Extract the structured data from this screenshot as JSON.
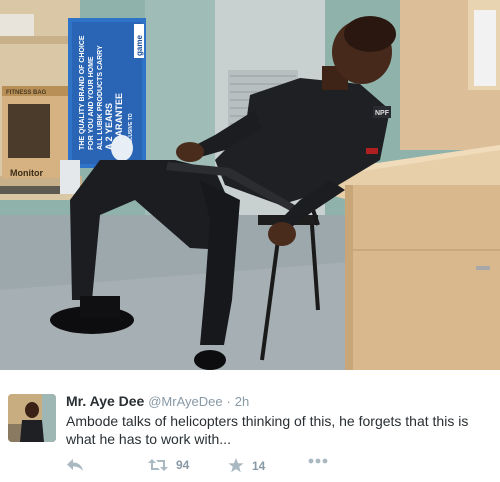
{
  "photo": {
    "box_label_top": "FITNESS BAG",
    "box_label_monitor": "Monitor",
    "poster_lines": [
      "THE QUALITY BRAND OF CHOICE",
      "FOR YOU AND YOUR HOME",
      "ALL LUBIK PRODUCTS CARRY",
      "A 2 YEARS",
      "GUARANTEE",
      "EXCLUSIVE TO"
    ],
    "poster_brand": "game",
    "badge": "NPF"
  },
  "tweet": {
    "display_name": "Mr. Aye Dee",
    "handle": "@MrAyeDee",
    "separator": "·",
    "time": "2h",
    "text": "Ambode talks of helicopters thinking of this, he forgets that this is what he has to work with...",
    "retweets": "94",
    "favorites": "14"
  },
  "icons": {
    "reply": "reply-icon",
    "retweet": "retweet-icon",
    "favorite": "star-icon",
    "more": "more-dots-icon"
  },
  "colors": {
    "text": "#292f33",
    "muted": "#8899a6",
    "icon": "#aab8c2"
  }
}
